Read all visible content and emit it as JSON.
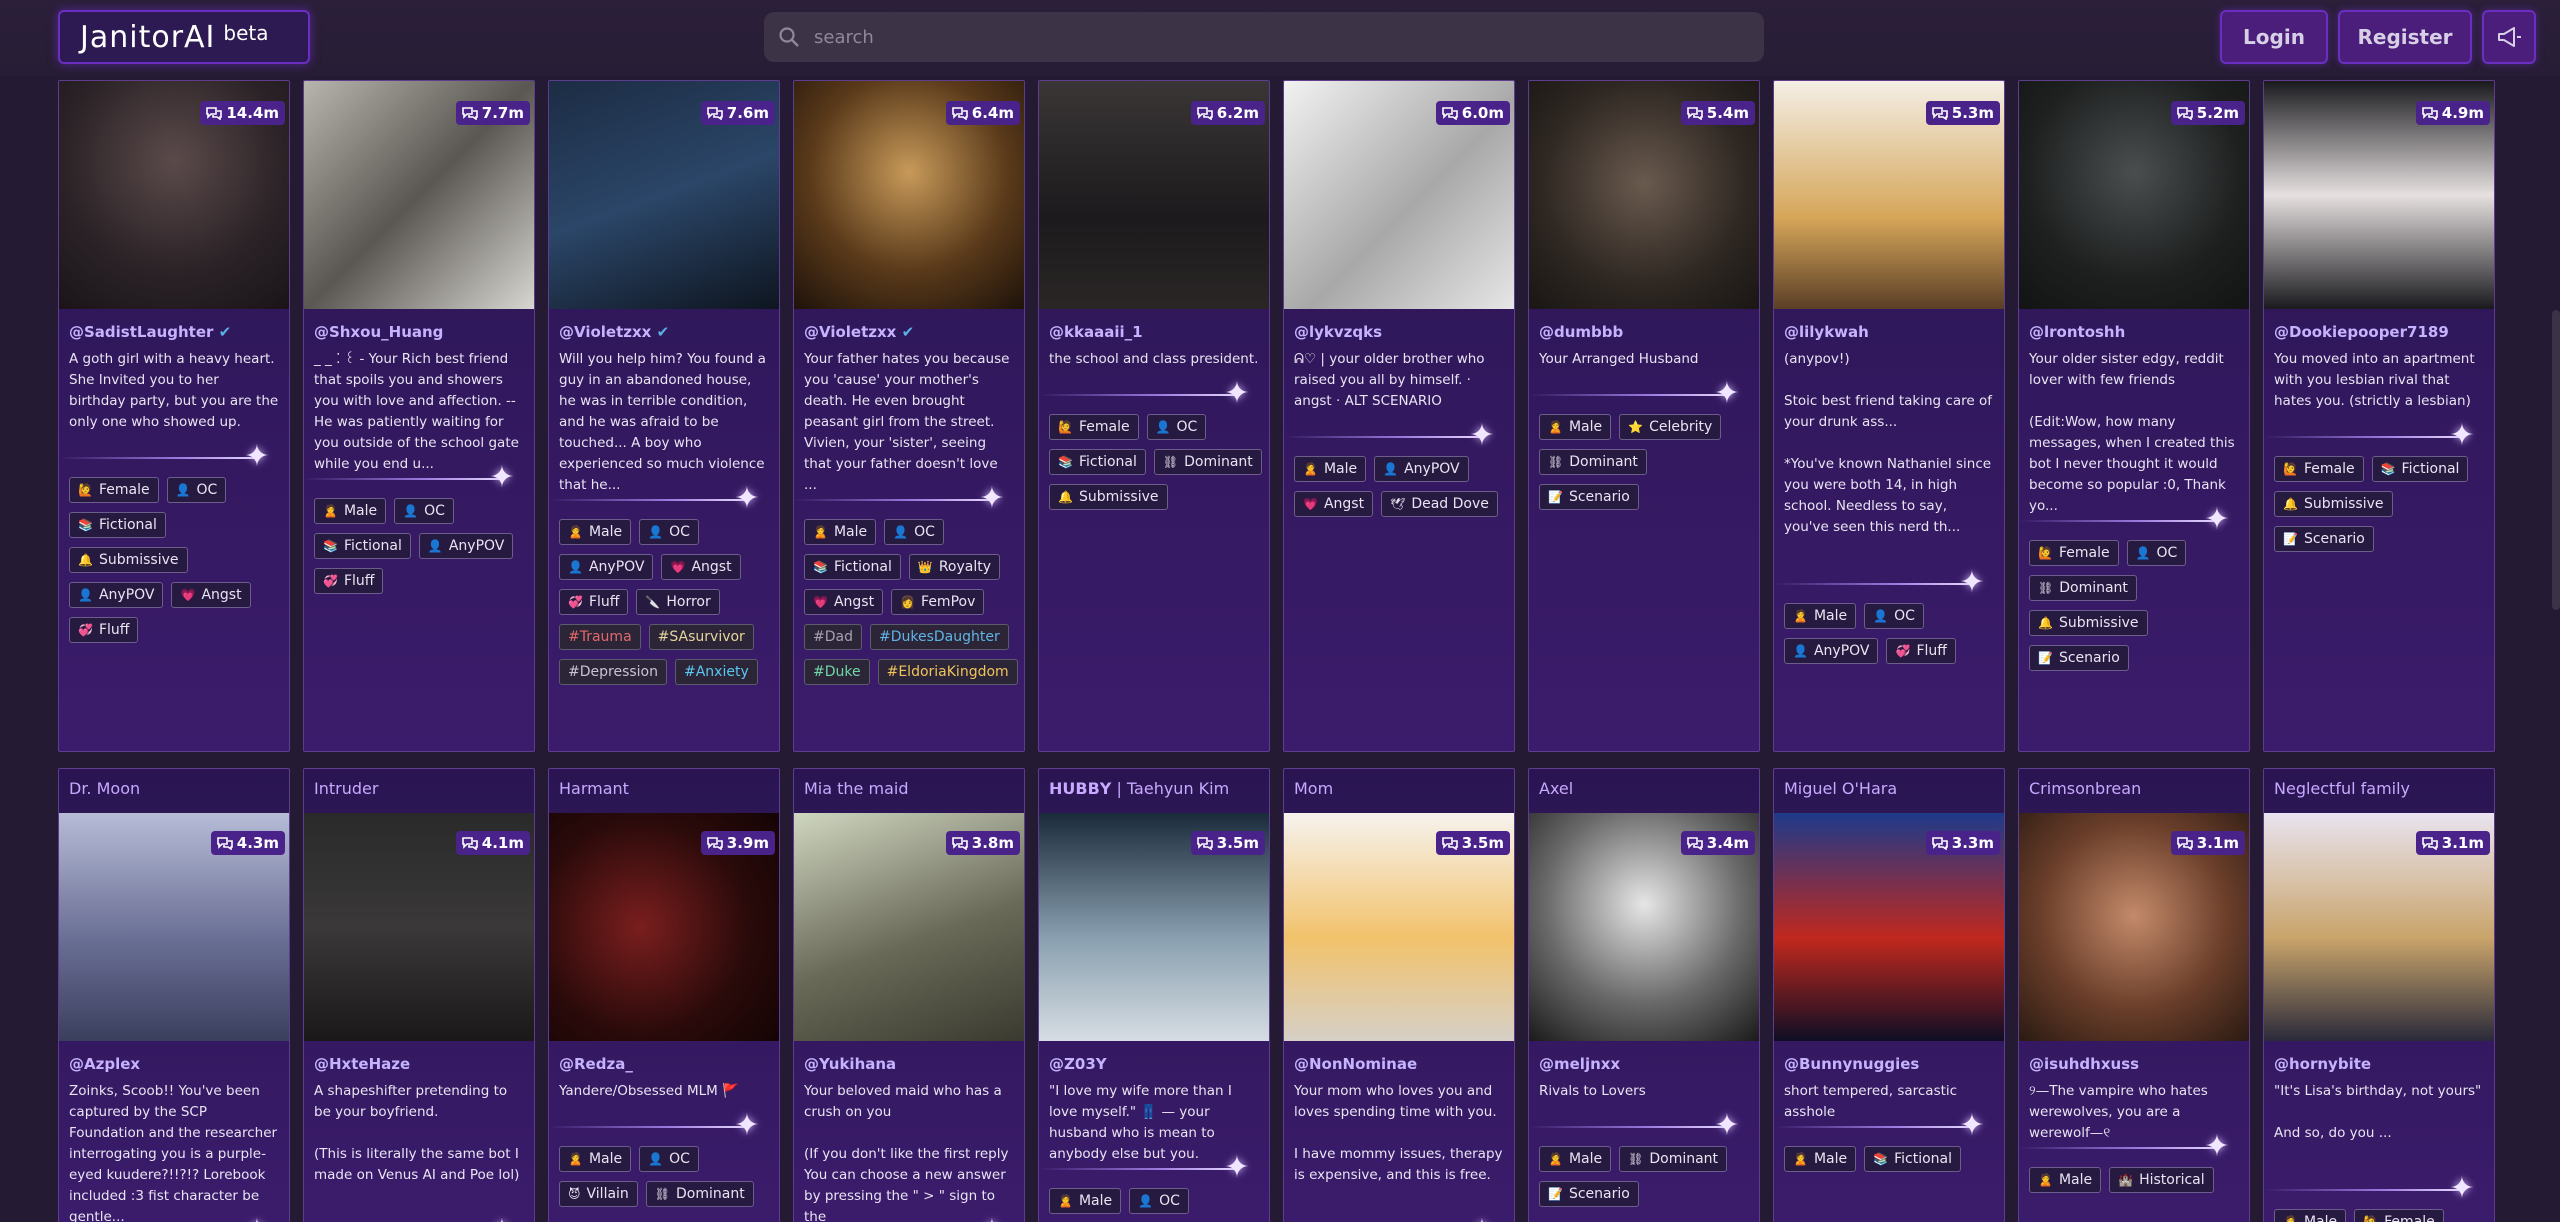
{
  "header": {
    "logo": "JanitorAI",
    "logo_badge": "beta",
    "search_placeholder": "search",
    "login": "Login",
    "register": "Register",
    "announce_icon": "megaphone-icon",
    "search_icon": "search-icon"
  },
  "row1": [
    {
      "badge": "14.4m",
      "author": "@SadistLaughter",
      "verified": true,
      "desc": "A goth girl with a heavy heart. She Invited you to her birthday party, but you are the only one who showed up.",
      "tags": [
        "Female",
        "OC",
        "Fictional",
        "Submissive",
        "AnyPOV",
        "Angst",
        "Fluff"
      ],
      "hashtags": []
    },
    {
      "badge": "7.7m",
      "author": "@Shxou_Huang",
      "verified": false,
      "desc": "_ _ ⁚ ꒰ - Your Rich best friend that spoils you and showers you with love and affection. -- He was patiently waiting for you outside of the school gate while you end u...",
      "tags": [
        "Male",
        "OC",
        "Fictional",
        "AnyPOV",
        "Fluff"
      ],
      "hashtags": []
    },
    {
      "badge": "7.6m",
      "author": "@Violetzxx",
      "verified": true,
      "desc": "Will you help him? You found a guy in an abandoned house, he was in terrible condition, and he was afraid to be touched... A boy who experienced so much violence that he...",
      "tags": [
        "Male",
        "OC",
        "AnyPOV",
        "Angst",
        "Fluff",
        "Horror"
      ],
      "hashtags": [
        "#Trauma",
        "#SAsurvivor",
        "#Depression",
        "#Anxiety"
      ]
    },
    {
      "badge": "6.4m",
      "author": "@Violetzxx",
      "verified": true,
      "desc": "Your father hates you because you 'cause' your mother's death. He even brought peasant girl from the street. Vivien, your 'sister', seeing that your father doesn't love ...",
      "tags": [
        "Male",
        "OC",
        "Fictional",
        "Royalty",
        "Angst",
        "FemPov"
      ],
      "hashtags": [
        "#Dad",
        "#DukesDaughter",
        "#Duke",
        "#EldoriaKingdom"
      ]
    },
    {
      "badge": "6.2m",
      "author": "@kkaaaii_1",
      "verified": false,
      "desc": "the school and class president.",
      "tags": [
        "Female",
        "OC",
        "Fictional",
        "Dominant",
        "Submissive"
      ],
      "hashtags": []
    },
    {
      "badge": "6.0m",
      "author": "@lykvzqks",
      "verified": false,
      "desc": "ᕱ♡ | your older brother who raised you all by himself. · angst · ALT SCENARIO",
      "tags": [
        "Male",
        "AnyPOV",
        "Angst",
        "Dead Dove"
      ],
      "hashtags": []
    },
    {
      "badge": "5.4m",
      "author": "@dumbbb",
      "verified": false,
      "desc": "Your Arranged Husband",
      "tags": [
        "Male",
        "Celebrity",
        "Dominant",
        "Scenario"
      ],
      "hashtags": []
    },
    {
      "badge": "5.3m",
      "author": "@lilykwah",
      "verified": false,
      "desc": "(anypov!)\n\nStoic best friend taking care of your drunk ass...\n\n*You've known Nathaniel since you were both 14, in high school. Needless to say, you've seen this nerd th...",
      "tags": [
        "Male",
        "OC",
        "AnyPOV",
        "Fluff"
      ],
      "hashtags": []
    },
    {
      "badge": "5.2m",
      "author": "@lrontoshh",
      "verified": false,
      "desc": "Your older sister edgy, reddit lover with few friends\n\n(Edit:Wow, how many messages, when I created this bot I never thought it would become so popular :0, Thank yo...",
      "tags": [
        "Female",
        "OC",
        "Dominant",
        "Submissive",
        "Scenario"
      ],
      "hashtags": []
    },
    {
      "badge": "4.9m",
      "author": "@Dookiepooper7189",
      "verified": false,
      "desc": "You moved into an apartment with you lesbian rival that hates you. (strictly a lesbian)",
      "tags": [
        "Female",
        "Fictional",
        "Submissive",
        "Scenario"
      ],
      "hashtags": []
    }
  ],
  "row2": [
    {
      "name": "Dr. Moon",
      "badge": "4.3m",
      "author": "@Azplex",
      "desc": "Zoinks, Scoob!! You've been captured by the SCP Foundation and the researcher interrogating you is a purple-eyed kuudere?!!?!? Lorebook included :3 fist character be gentle...",
      "tags": []
    },
    {
      "name": "Intruder",
      "badge": "4.1m",
      "author": "@HxteHaze",
      "desc": "A shapeshifter pretending to be your boyfriend.\n\n(This is literally the same bot I made on Venus AI and Poe lol)",
      "tags": []
    },
    {
      "name": "Harmant",
      "badge": "3.9m",
      "author": "@Redza_",
      "desc": "Yandere/Obsessed MLM 🚩",
      "tags": [
        "Male",
        "OC",
        "Villain",
        "Dominant"
      ]
    },
    {
      "name": "Mia the maid",
      "badge": "3.8m",
      "author": "@Yukihana",
      "desc": "Your beloved maid who has a crush on you\n\n(If you don't like the first reply You can choose a new answer by pressing the \" > \" sign to the",
      "tags": []
    },
    {
      "name": "𝗛𝗨𝗕𝗕𝗬 | Taehyun Kim",
      "badge": "3.5m",
      "author": "@Z03Y",
      "desc": "\"I love my wife more than I love myself.\" 👖 — your husband who is mean to anybody else but you.",
      "tags": [
        "Male",
        "OC"
      ]
    },
    {
      "name": "Mom",
      "badge": "3.5m",
      "author": "@NonNominae",
      "desc": "Your mom who loves you and loves spending time with you.\n\nI have mommy issues, therapy is expensive, and this is free.",
      "tags": []
    },
    {
      "name": "Axel",
      "badge": "3.4m",
      "author": "@meljnxx",
      "desc": "Rivals to Lovers",
      "tags": [
        "Male",
        "Dominant",
        "Scenario"
      ]
    },
    {
      "name": "Miguel O'Hara",
      "badge": "3.3m",
      "author": "@Bunnynuggies",
      "desc": "short tempered, sarcastic asshole",
      "tags": [
        "Male",
        "Fictional"
      ]
    },
    {
      "name": "Crimsonbrean",
      "badge": "3.1m",
      "author": "@isuhdhxuss",
      "desc": "୨—The vampire who hates werewolves, you are a werewolf—୧",
      "tags": [
        "Male",
        "Historical"
      ]
    },
    {
      "name": "Neglectful family",
      "badge": "3.1m",
      "author": "@hornybite",
      "desc": "\"It's Lisa's birthday, not yours\"\n\nAnd so, do you ...",
      "tags": [
        "Male",
        "Female"
      ]
    }
  ]
}
